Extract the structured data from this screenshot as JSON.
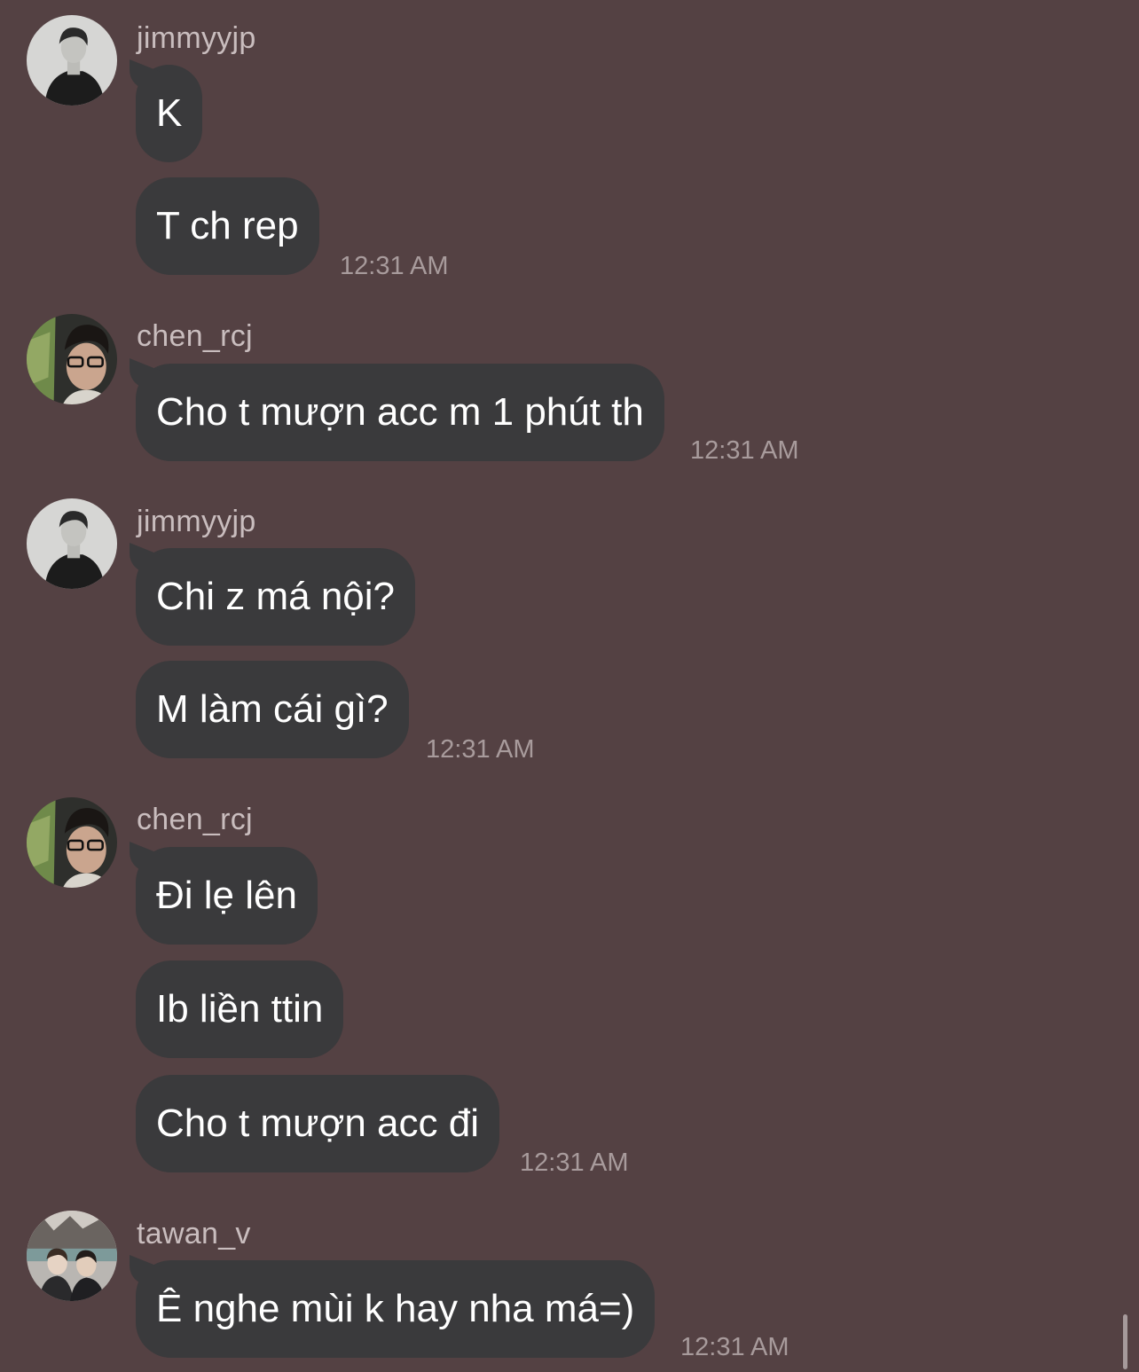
{
  "colors": {
    "background": "#544143",
    "bubble": "#3a3a3c",
    "sender_text": "#c9bdbe",
    "time_text": "#a89b9c",
    "message_text": "#ffffff"
  },
  "groups": [
    {
      "sender": "jimmyyjp",
      "avatar": "avatar-jimmyyjp",
      "messages": [
        "K",
        "T ch rep"
      ],
      "time": "12:31 AM"
    },
    {
      "sender": "chen_rcj",
      "avatar": "avatar-chen-rcj",
      "messages": [
        "Cho t mượn acc m 1 phút th"
      ],
      "time": "12:31 AM"
    },
    {
      "sender": "jimmyyjp",
      "avatar": "avatar-jimmyyjp",
      "messages": [
        "Chi z má nội?",
        "M làm cái gì?"
      ],
      "time": "12:31 AM"
    },
    {
      "sender": "chen_rcj",
      "avatar": "avatar-chen-rcj",
      "messages": [
        "Đi lẹ lên",
        "Ib liền ttin",
        "Cho t mượn acc đi"
      ],
      "time": "12:31 AM"
    },
    {
      "sender": "tawan_v",
      "avatar": "avatar-tawan-v",
      "messages": [
        "Ê nghe mùi k hay nha má=)"
      ],
      "time": "12:31 AM"
    }
  ]
}
